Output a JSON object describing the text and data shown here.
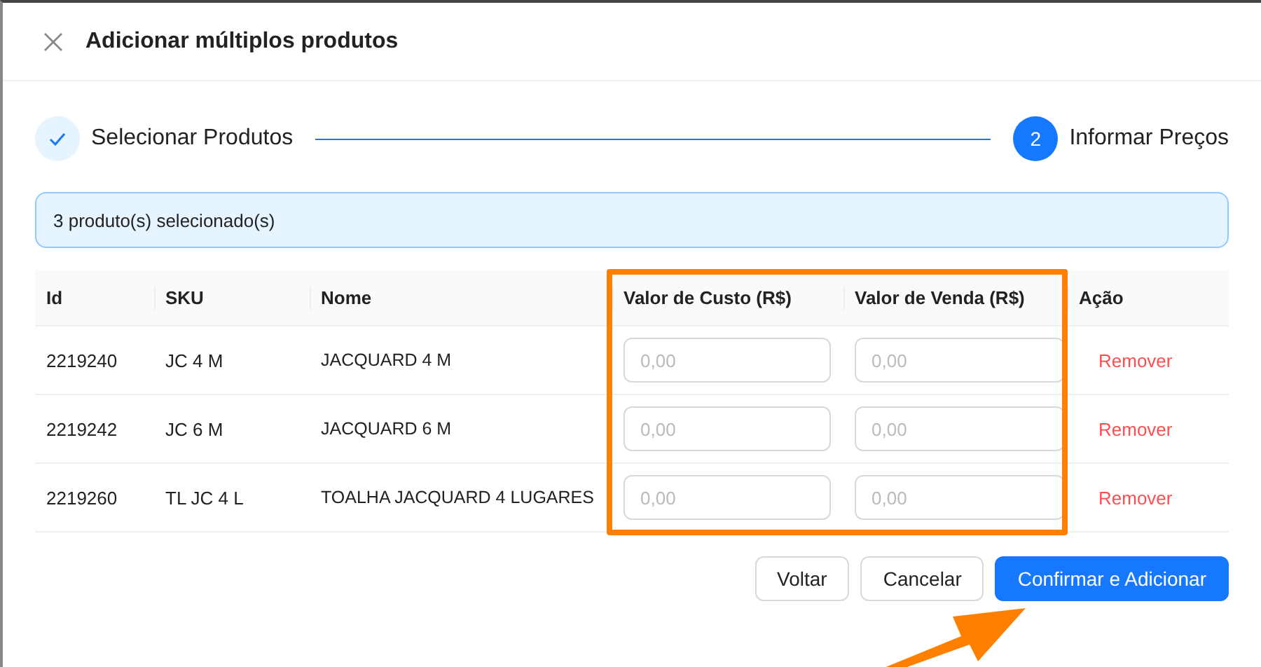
{
  "dialog": {
    "title": "Adicionar múltiplos produtos"
  },
  "steps": [
    {
      "label": "Selecionar Produtos",
      "kind": "done"
    },
    {
      "label": "Informar Preços",
      "number": "2",
      "kind": "active"
    }
  ],
  "info_banner": "3 produto(s) selecionado(s)",
  "table": {
    "columns": [
      "Id",
      "SKU",
      "Nome",
      "Valor de Custo (R$)",
      "Valor de Venda (R$)",
      "Ação"
    ],
    "rows": [
      {
        "id": "2219240",
        "sku": "JC 4 M",
        "name": "JACQUARD 4 M",
        "cost_placeholder": "0,00",
        "sale_placeholder": "0,00",
        "action": "Remover"
      },
      {
        "id": "2219242",
        "sku": "JC 6 M",
        "name": "JACQUARD 6 M",
        "cost_placeholder": "0,00",
        "sale_placeholder": "0,00",
        "action": "Remover"
      },
      {
        "id": "2219260",
        "sku": "TL JC 4 L",
        "name": "TOALHA JACQUARD 4 LUGARES",
        "cost_placeholder": "0,00",
        "sale_placeholder": "0,00",
        "action": "Remover"
      }
    ]
  },
  "buttons": [
    {
      "label": "Voltar",
      "kind": "default"
    },
    {
      "label": "Cancelar",
      "kind": "default"
    },
    {
      "label": "Confirmar e Adicionar",
      "kind": "primary"
    }
  ]
}
